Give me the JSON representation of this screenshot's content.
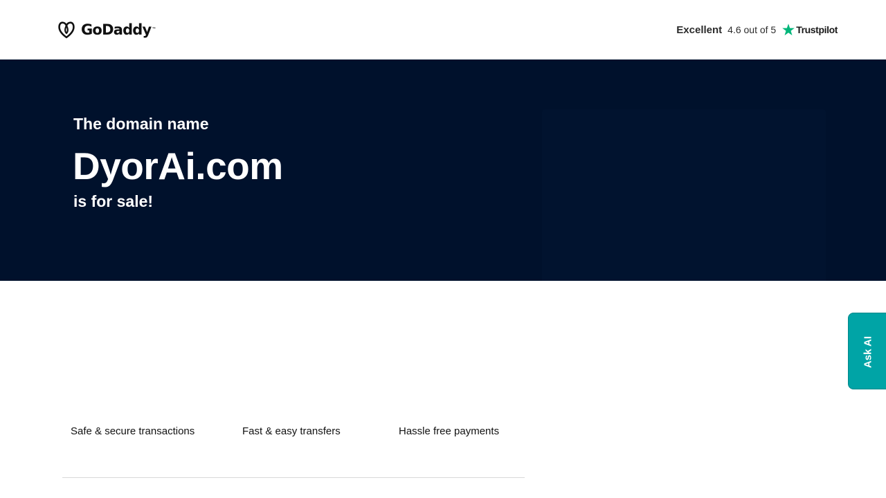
{
  "header": {
    "logo": {
      "name": "GoDaddy",
      "icon": "godaddy-logo-icon"
    },
    "rating": {
      "label": "Excellent",
      "score_text": "4.6 out of 5",
      "provider": "Trustpilot",
      "icon": "trustpilot-star-icon",
      "star_color": "#00b67a"
    }
  },
  "hero": {
    "eyebrow": "The domain name",
    "domain": "DyorAi.com",
    "tagline": "is for sale!",
    "background_color": "#00112c"
  },
  "features": [
    {
      "label": "Safe & secure transactions"
    },
    {
      "label": "Fast & easy transfers"
    },
    {
      "label": "Hassle free payments"
    }
  ],
  "ask_ai": {
    "label": "Ask AI",
    "color": "#00a4a6"
  }
}
